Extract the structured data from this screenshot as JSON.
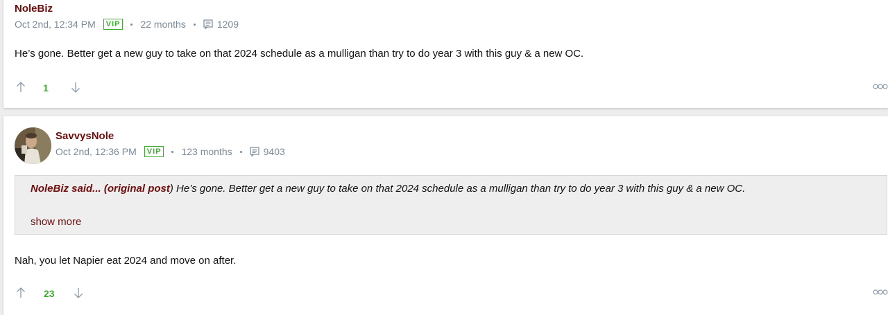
{
  "colors": {
    "accent": "#6e0d0d",
    "vip": "#3aae2a",
    "upvote_count": "#3aae2a",
    "meta_text": "#7b8a99"
  },
  "posts": [
    {
      "author": "NoleBiz",
      "timestamp": "Oct 2nd, 12:34 PM",
      "badge": "VIP",
      "tenure": "22 months",
      "post_count": "1209",
      "text": "He’s gone. Better get a new guy to take on that 2024 schedule as a mulligan than try to do year 3 with this guy & a new OC.",
      "votes": "1",
      "icons": [
        "post-count-icon",
        "upvote-icon",
        "downvote-icon",
        "more-options-icon"
      ]
    },
    {
      "author": "SavvysNole",
      "timestamp": "Oct 2nd, 12:36 PM",
      "badge": "VIP",
      "tenure": "123 months",
      "post_count": "9403",
      "quote": {
        "author_label": "NoleBiz said... (original post",
        "author_link": "original post",
        "closing": ")",
        "text": "He’s gone. Better get a new guy to take on that 2024 schedule as a mulligan than try to do year 3 with this guy & a new OC.",
        "show_more": "show more"
      },
      "text": "Nah, you let Napier eat 2024 and move on after.",
      "votes": "23",
      "icons": [
        "avatar",
        "post-count-icon",
        "upvote-icon",
        "downvote-icon",
        "more-options-icon"
      ]
    }
  ]
}
